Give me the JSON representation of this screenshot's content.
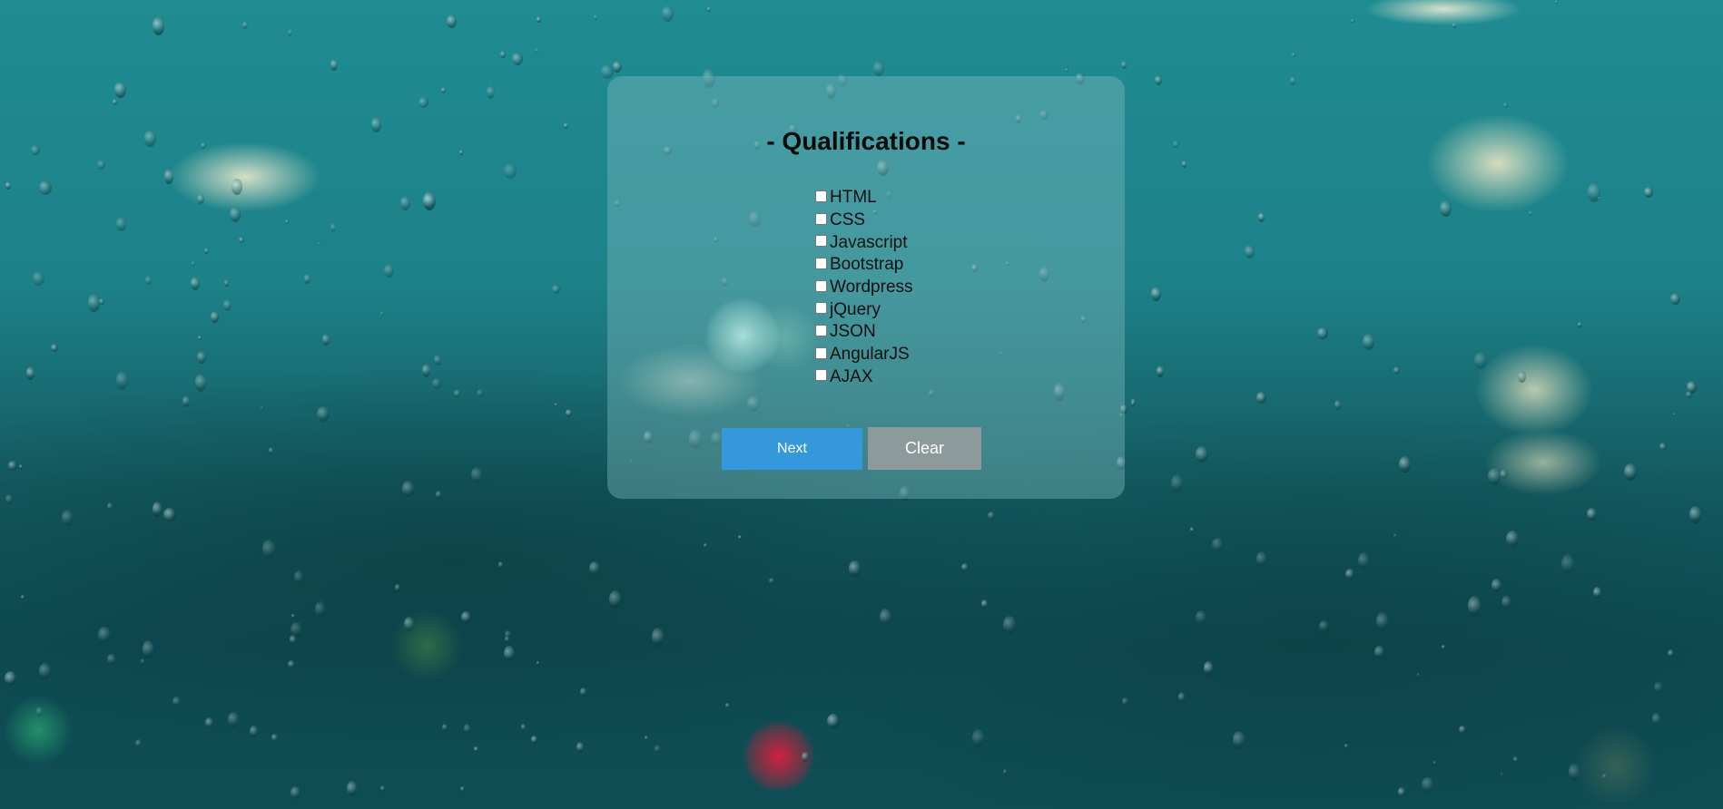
{
  "form": {
    "title": "- Qualifications -",
    "options": [
      {
        "label": "HTML",
        "checked": false
      },
      {
        "label": "CSS",
        "checked": false
      },
      {
        "label": "Javascript",
        "checked": false
      },
      {
        "label": "Bootstrap",
        "checked": false
      },
      {
        "label": "Wordpress",
        "checked": false
      },
      {
        "label": "jQuery",
        "checked": false
      },
      {
        "label": "JSON",
        "checked": false
      },
      {
        "label": "AngularJS",
        "checked": false
      },
      {
        "label": "AJAX",
        "checked": false
      }
    ],
    "next_label": "Next",
    "clear_label": "Clear"
  },
  "colors": {
    "next_button": "#3498db",
    "clear_button": "#8c9a9c",
    "background": "#1d8188"
  }
}
